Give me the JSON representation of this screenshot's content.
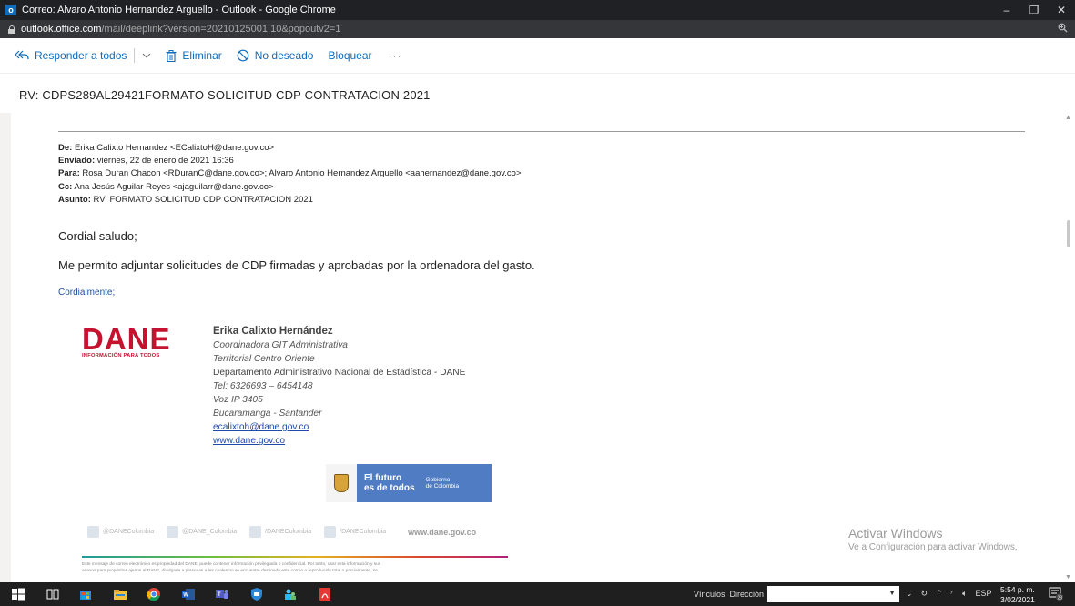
{
  "window": {
    "title": "Correo: Alvaro Antonio Hernandez Arguello - Outlook - Google Chrome",
    "controls": [
      "–",
      "❐",
      "✕"
    ]
  },
  "address": {
    "host": "outlook.office.com",
    "path": "/mail/deeplink?version=20210125001.10&popoutv2=1",
    "zoom_icon": "zoom-icon"
  },
  "toolbar": {
    "reply_all": "Responder a todos",
    "delete": "Eliminar",
    "junk": "No deseado",
    "block": "Bloquear",
    "more": "···",
    "accent": "#0f6cbd"
  },
  "subject": "RV: CDPS289AL29421FORMATO SOLICITUD CDP CONTRATACION 2021",
  "header": {
    "from_label": "De:",
    "from": " Erika Calixto Hernandez <ECalixtoH@dane.gov.co>",
    "sent_label": "Enviado:",
    "sent": " viernes, 22 de enero de 2021 16:36",
    "to_label": "Para:",
    "to": " Rosa Duran Chacon <RDuranC@dane.gov.co>; Alvaro Antonio Hernandez Arguello <aahernandez@dane.gov.co>",
    "cc_label": "Cc:",
    "cc": " Ana Jesús Aguilar Reyes <ajaguilarr@dane.gov.co>",
    "subject_label": "Asunto:",
    "subject": " RV: FORMATO SOLICITUD CDP CONTRATACION 2021"
  },
  "body": {
    "greeting": "Cordial saludo;",
    "paragraph": "Me permito adjuntar solicitudes de CDP firmadas y aprobadas por la ordenadora del gasto.",
    "closing": "Cordialmente;"
  },
  "logo": {
    "text": "DANE",
    "tagline": "INFORMACIÓN PARA TODOS",
    "color": "#c4122f"
  },
  "signature": {
    "name": "Erika Calixto Hernández",
    "role": "Coordinadora GIT Administrativa",
    "unit": "Territorial Centro Oriente",
    "org": "Departamento Administrativo Nacional de Estadística - DANE",
    "tel": "Tel:  6326693 – 6454148",
    "voip": "Voz IP 3405",
    "city": "Bucaramanga - Santander",
    "email": "ecalixtoh@dane.gov.co",
    "web": "www.dane.gov.co"
  },
  "gov_banner": {
    "line1": "El futuro",
    "line2": "es de todos",
    "line3": "Gobierno",
    "line4": "de Colombia"
  },
  "social": {
    "items": [
      "@DANEColombia",
      "@DANE_Colombia",
      "/DANEColombia",
      "/DANEColombia"
    ],
    "url": "www.dane.gov.co"
  },
  "disclaimer": {
    "line1": "Este mensaje de correo electrónico es propiedad del DANE, puede contener información privilegiada o confidencial. Por tanto, usar esta información y sus",
    "line2": "anexos para propósitos ajenos al DANE, divulgarla a personas a las cuales no se encuentre destinado este correo o reproducirla total o parcialmente, se"
  },
  "watermark": {
    "title": "Activar Windows",
    "subtitle": "Ve a Configuración para activar Windows."
  },
  "taskbar": {
    "links": "Vínculos",
    "direction": "Dirección",
    "lang": "ESP",
    "time": "5:54 p. m.",
    "date": "3/02/2021",
    "notif_count": "23"
  }
}
